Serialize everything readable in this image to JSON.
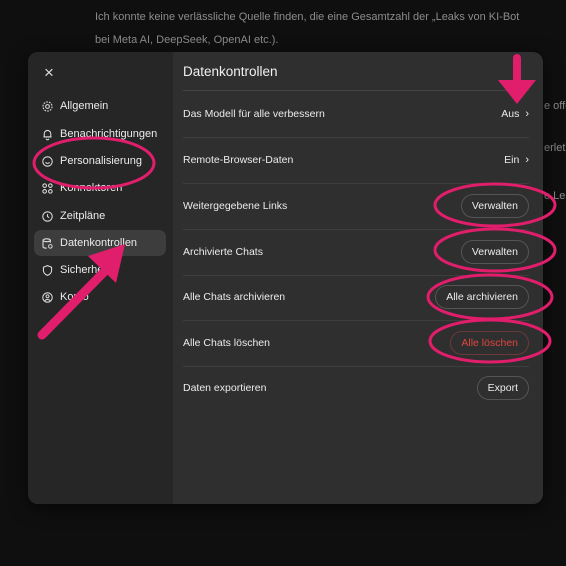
{
  "background": {
    "line1": "Ich konnte keine verlässliche Quelle finden, die eine Gesamtzahl der „Leaks von KI-Bot",
    "line2": "bei Meta AI, DeepSeek, OpenAI etc.).",
    "frag1": "e offe",
    "frag2": "erlet",
    "frag3": "e Le"
  },
  "modal": {
    "close_label": "×",
    "title": "Datenkontrollen"
  },
  "sidebar": {
    "items": [
      {
        "label": "Allgemein",
        "icon": "gear-icon"
      },
      {
        "label": "Benachrichtigungen",
        "icon": "bell-icon"
      },
      {
        "label": "Personalisierung",
        "icon": "personalization-icon"
      },
      {
        "label": "Konnektoren",
        "icon": "connectors-icon"
      },
      {
        "label": "Zeitpläne",
        "icon": "clock-icon"
      },
      {
        "label": "Datenkontrollen",
        "icon": "database-icon"
      },
      {
        "label": "Sicherheit",
        "icon": "shield-icon"
      },
      {
        "label": "Konto",
        "icon": "account-icon"
      }
    ],
    "active_index": 5
  },
  "settings": {
    "rows": [
      {
        "label": "Das Modell für alle verbessern",
        "value": "Aus",
        "type": "link"
      },
      {
        "label": "Remote-Browser-Daten",
        "value": "Ein",
        "type": "link"
      },
      {
        "label": "Weitergegebene Links",
        "value": "Verwalten",
        "type": "button"
      },
      {
        "label": "Archivierte Chats",
        "value": "Verwalten",
        "type": "button"
      },
      {
        "label": "Alle Chats archivieren",
        "value": "Alle archivieren",
        "type": "button"
      },
      {
        "label": "Alle Chats löschen",
        "value": "Alle löschen",
        "type": "danger-button"
      },
      {
        "label": "Daten exportieren",
        "value": "Export",
        "type": "button"
      }
    ]
  },
  "annotation_color": "#e01e6b"
}
